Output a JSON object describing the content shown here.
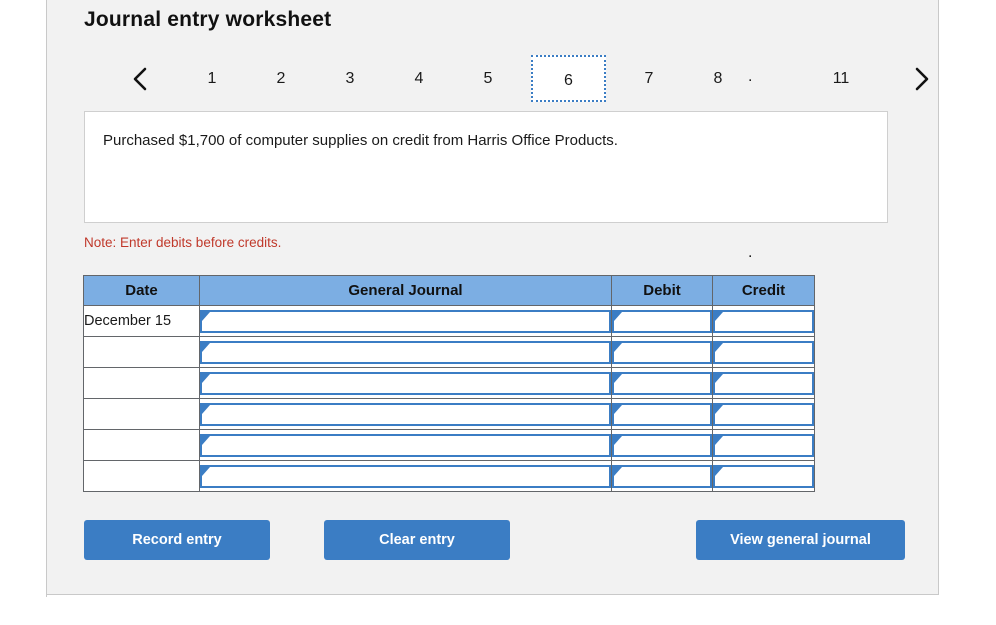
{
  "panel": {
    "title": "Journal entry worksheet"
  },
  "pager": {
    "prev_icon": "chevron-left-icon",
    "next_icon": "chevron-right-icon",
    "pages": [
      "1",
      "2",
      "3",
      "4",
      "5",
      "6",
      "7",
      "8"
    ],
    "ellipsis": ". . . . .",
    "last_page": "11",
    "selected": "6"
  },
  "description": {
    "text": "Purchased $1,700 of computer supplies on credit from Harris Office Products."
  },
  "note": {
    "text": "Note: Enter debits before credits."
  },
  "table": {
    "headers": [
      "Date",
      "General Journal",
      "Debit",
      "Credit"
    ],
    "rows": [
      {
        "date": "December 15",
        "general_journal": "",
        "debit": "",
        "credit": ""
      },
      {
        "date": "",
        "general_journal": "",
        "debit": "",
        "credit": ""
      },
      {
        "date": "",
        "general_journal": "",
        "debit": "",
        "credit": ""
      },
      {
        "date": "",
        "general_journal": "",
        "debit": "",
        "credit": ""
      },
      {
        "date": "",
        "general_journal": "",
        "debit": "",
        "credit": ""
      },
      {
        "date": "",
        "general_journal": "",
        "debit": "",
        "credit": ""
      }
    ]
  },
  "buttons": {
    "record": "Record entry",
    "clear": "Clear entry",
    "view": "View general journal"
  },
  "colors": {
    "accent_blue": "#3b7dc4",
    "header_blue": "#7caee3",
    "note_red": "#c0392b",
    "panel_gray": "#f2f2f2"
  }
}
